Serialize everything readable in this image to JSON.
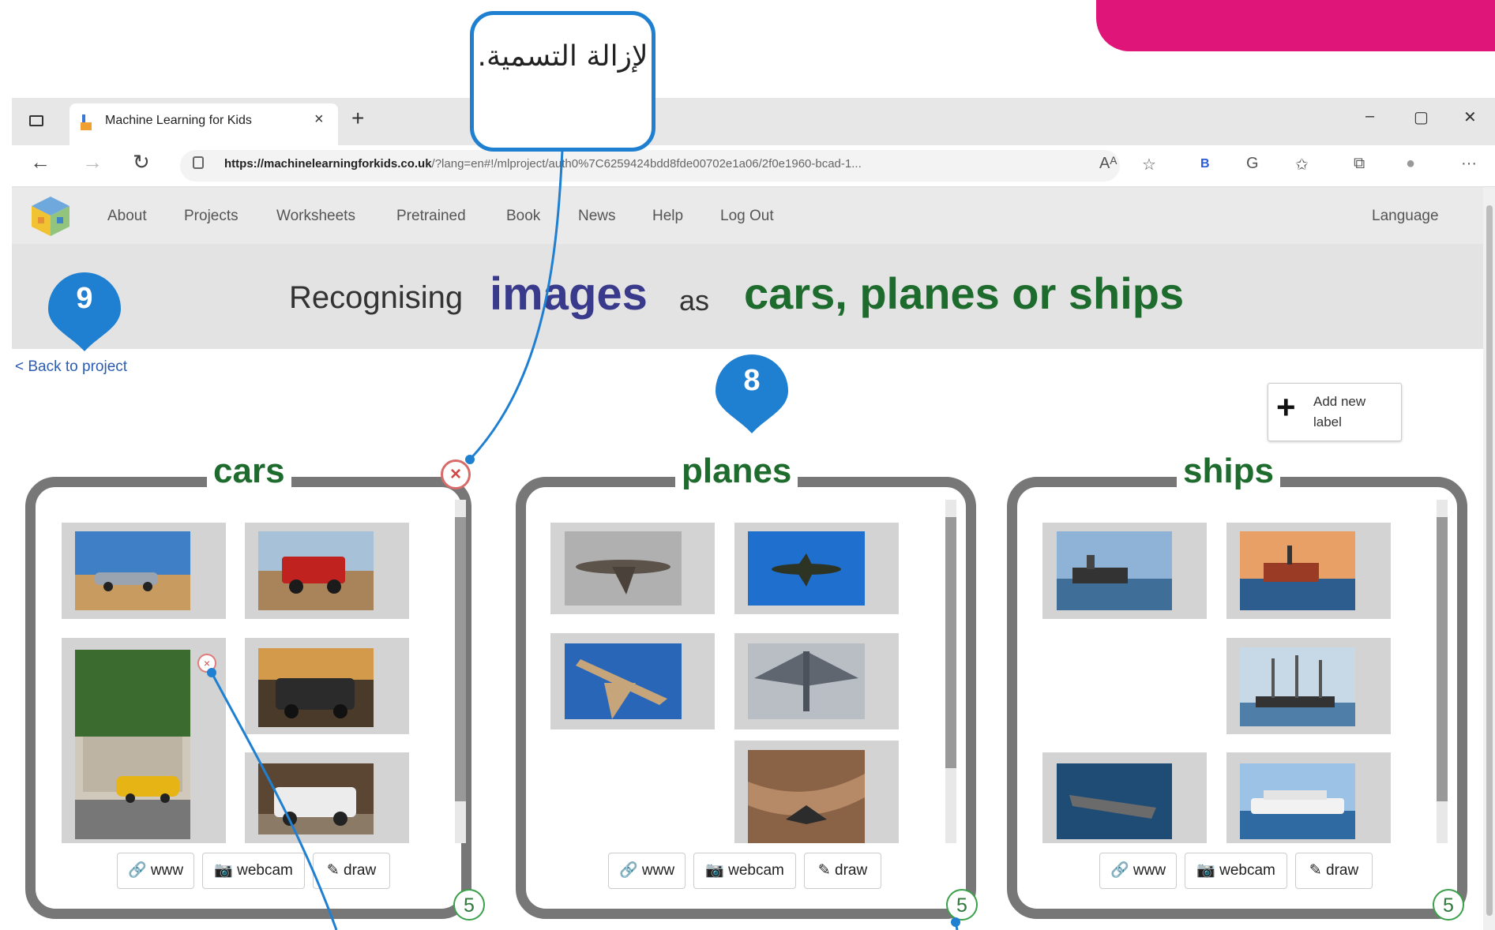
{
  "callout": {
    "text": "لإزالة التسمية."
  },
  "markers": {
    "project_marker": "9",
    "labels_marker": "8"
  },
  "browser": {
    "tab_title": "Machine Learning for Kids",
    "tab_close": "×",
    "new_tab": "+",
    "url_host": "https://machinelearningforkids.co.uk",
    "url_rest": "/?lang=en#!/mlproject/auth0%7C6259424bdd8fde00702e1a06/2f0e1960-bcad-1...",
    "controls": {
      "minimize": "–",
      "maximize": "▢",
      "close": "✕"
    },
    "toolbar": [
      "Aᴬ",
      "☆",
      "B",
      "G",
      "✩",
      "⧉",
      "●",
      "···"
    ]
  },
  "site": {
    "nav": [
      "About",
      "Projects",
      "Worksheets",
      "Pretrained",
      "Book",
      "News",
      "Help",
      "Log Out"
    ],
    "language": "Language",
    "title": {
      "w1": "Recognising",
      "w2": "images",
      "w3": "as",
      "w4": "cars, planes or ships"
    },
    "back_link": "< Back to project",
    "add_label": "Add new label"
  },
  "labels": [
    {
      "name": "cars",
      "count": "5"
    },
    {
      "name": "planes",
      "count": "5"
    },
    {
      "name": "ships",
      "count": "5"
    }
  ],
  "tools": {
    "www": "www",
    "webcam": "webcam",
    "draw": "draw"
  },
  "colors": {
    "callout_border": "#1f7fd0",
    "label_green": "#1e6b2e",
    "images_blue": "#3a3a8c",
    "banner_pink": "#e0157a"
  }
}
